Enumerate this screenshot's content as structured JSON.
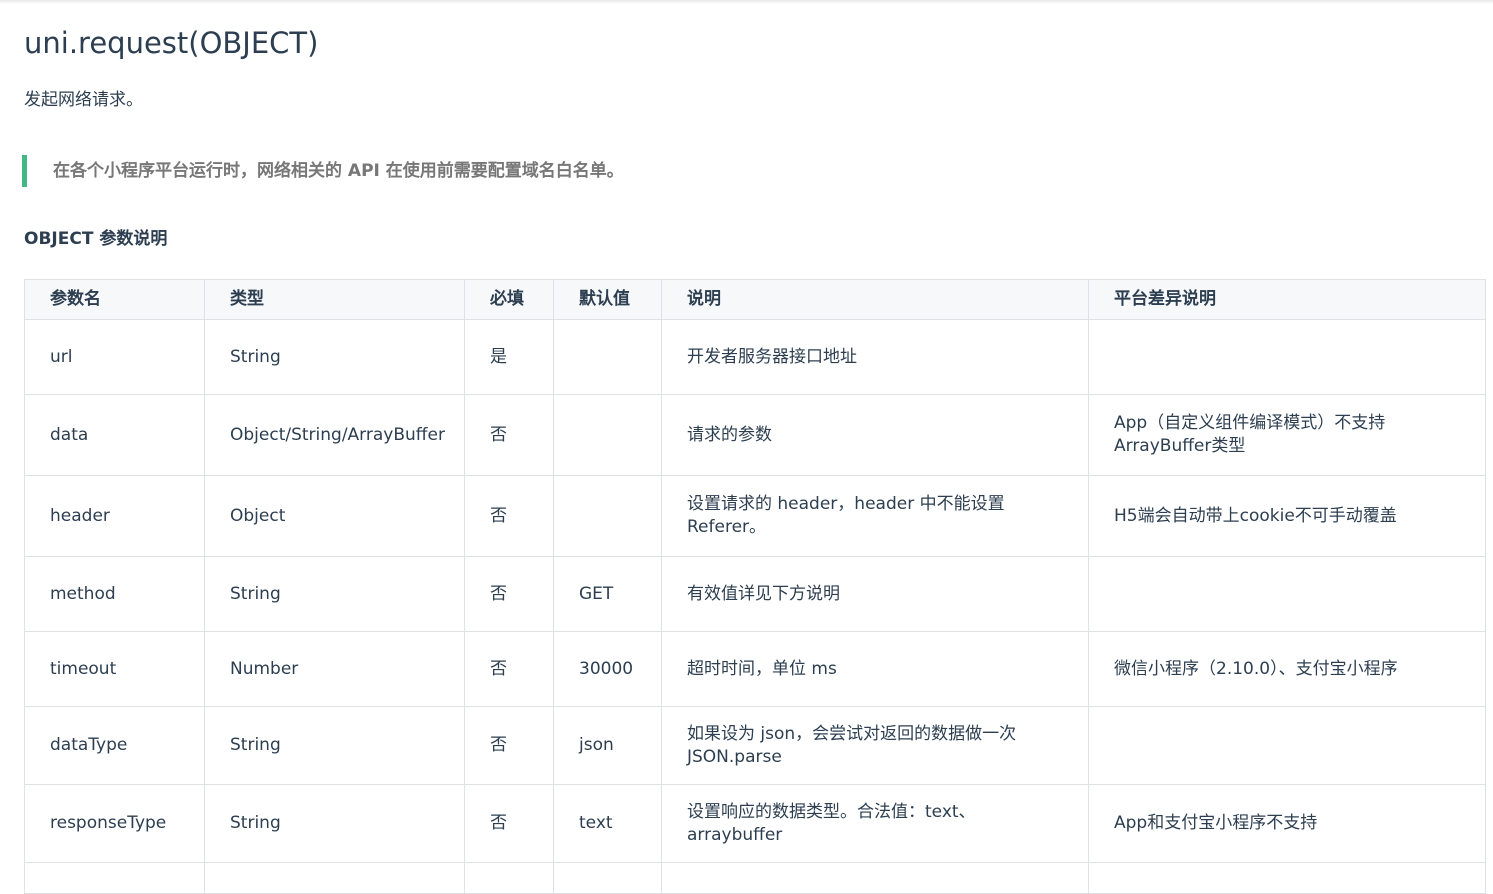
{
  "title": "uni.request(OBJECT)",
  "description": "发起网络请求。",
  "tip": "在各个小程序平台运行时，网络相关的 API 在使用前需要配置域名白名单。",
  "section_title": "OBJECT 参数说明",
  "table": {
    "headers": [
      "参数名",
      "类型",
      "必填",
      "默认值",
      "说明",
      "平台差异说明"
    ],
    "rows": [
      [
        "url",
        "String",
        "是",
        "",
        "开发者服务器接口地址",
        ""
      ],
      [
        "data",
        "Object/String/ArrayBuffer",
        "否",
        "",
        "请求的参数",
        "App（自定义组件编译模式）不支持ArrayBuffer类型"
      ],
      [
        "header",
        "Object",
        "否",
        "",
        "设置请求的 header，header 中不能设置 Referer。",
        "H5端会自动带上cookie不可手动覆盖"
      ],
      [
        "method",
        "String",
        "否",
        "GET",
        "有效值详见下方说明",
        ""
      ],
      [
        "timeout",
        "Number",
        "否",
        "30000",
        "超时时间，单位 ms",
        "微信小程序（2.10.0）、支付宝小程序"
      ],
      [
        "dataType",
        "String",
        "否",
        "json",
        "如果设为 json，会尝试对返回的数据做一次 JSON.parse",
        ""
      ],
      [
        "responseType",
        "String",
        "否",
        "text",
        "设置响应的数据类型。合法值：text、arraybuffer",
        "App和支付宝小程序不支持"
      ]
    ]
  }
}
